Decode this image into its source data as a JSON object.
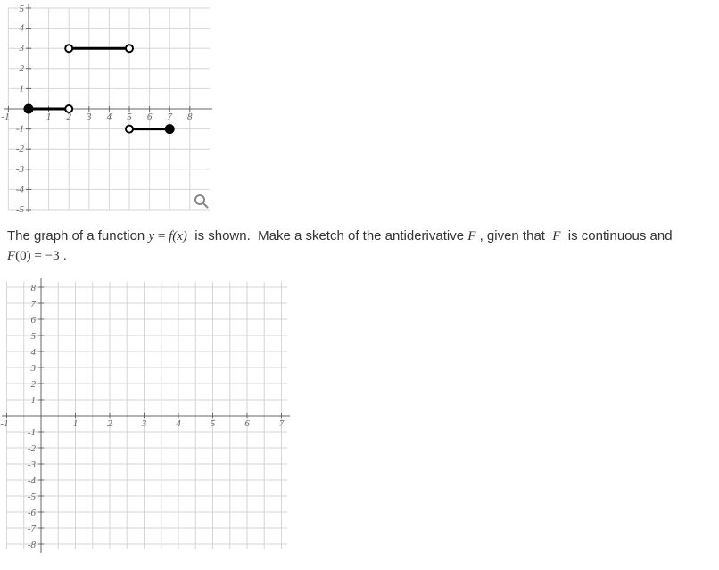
{
  "chart_data": [
    {
      "type": "line",
      "title": "",
      "xlabel": "",
      "ylabel": "",
      "xlim": [
        -1,
        8
      ],
      "ylim": [
        -5,
        5
      ],
      "x_ticks": [
        -1,
        1,
        2,
        3,
        4,
        5,
        6,
        7,
        8
      ],
      "y_ticks": [
        -5,
        -4,
        -3,
        -2,
        -1,
        1,
        2,
        3,
        4,
        5
      ],
      "series": [
        {
          "name": "segment1",
          "x": [
            0,
            2
          ],
          "y": [
            0,
            0
          ],
          "left_closed": true,
          "right_closed": false
        },
        {
          "name": "segment2",
          "x": [
            2,
            5
          ],
          "y": [
            3,
            3
          ],
          "left_closed": false,
          "right_closed": false
        },
        {
          "name": "segment3",
          "x": [
            5,
            7
          ],
          "y": [
            -1,
            -1
          ],
          "left_closed": false,
          "right_closed": true
        }
      ]
    },
    {
      "type": "blank-grid",
      "title": "",
      "xlabel": "",
      "ylabel": "",
      "xlim": [
        -1,
        7
      ],
      "ylim": [
        -8,
        8
      ],
      "x_ticks": [
        -1,
        1,
        2,
        3,
        4,
        5,
        6,
        7
      ],
      "y_ticks": [
        -8,
        -7,
        -6,
        -5,
        -4,
        -3,
        -2,
        -1,
        1,
        2,
        3,
        4,
        5,
        6,
        7,
        8
      ]
    }
  ],
  "prompt": {
    "pre": "The graph of a function ",
    "eq1_lhs": "y",
    "eq1_eq": " = ",
    "eq1_rhs": "f(x)",
    "mid1": "  is shown.  Make a sketch of the antiderivative ",
    "F1": "F",
    "mid2": " , given that  ",
    "F2": "F",
    "mid3": "  is continuous and ",
    "cond": "F(0) = −3",
    "end": " ."
  },
  "magnifier_icon": "magnifier-icon"
}
